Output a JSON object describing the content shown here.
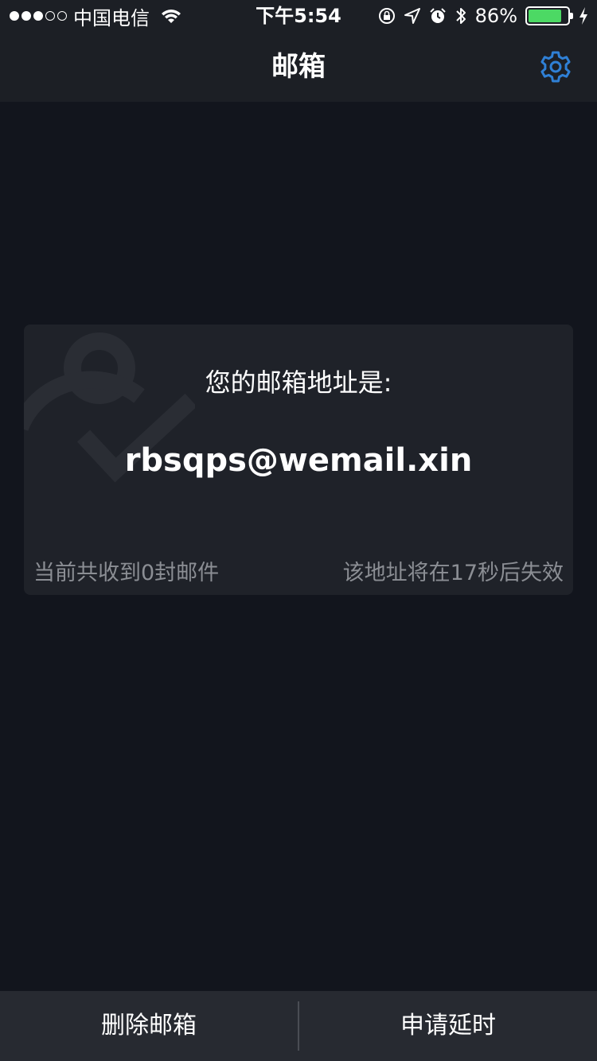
{
  "status_bar": {
    "carrier": "中国电信",
    "time": "下午5:54",
    "battery": "86%",
    "battery_level": 0.86,
    "signal_bars": 3,
    "signal_total": 5
  },
  "nav": {
    "title": "邮箱",
    "settings_icon": "gear-icon",
    "accent_color": "#2f80d6"
  },
  "card": {
    "label": "您的邮箱地址是:",
    "email": "rbsqps@wemail.xin",
    "received_count": "当前共收到0封邮件",
    "expiry_text": "该地址将在17秒后失效",
    "watermark_icon": "user-check-icon"
  },
  "actions": {
    "delete_label": "删除邮箱",
    "extend_label": "申请延时"
  }
}
